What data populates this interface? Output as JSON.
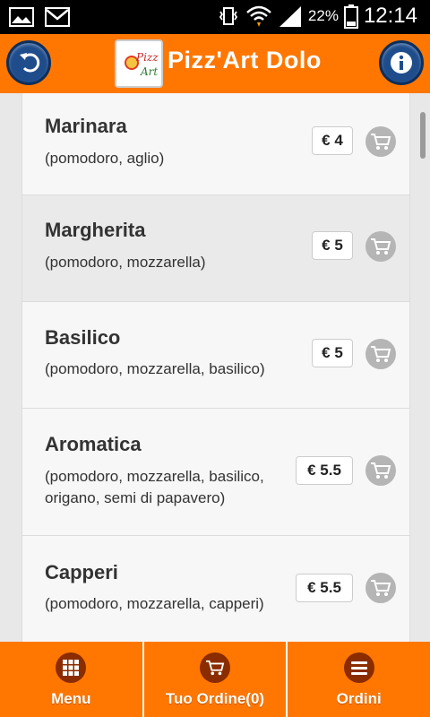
{
  "status_bar": {
    "battery": "22%",
    "time": "12:14"
  },
  "header": {
    "title": "Pizz'Art Dolo",
    "logo_text": "Pizz Art"
  },
  "menu_items": [
    {
      "name": "Marinara",
      "desc": "(pomodoro, aglio)",
      "price": "€ 4"
    },
    {
      "name": "Margherita",
      "desc": "(pomodoro, mozzarella)",
      "price": "€ 5"
    },
    {
      "name": "Basilico",
      "desc": "(pomodoro, mozzarella, basilico)",
      "price": "€ 5"
    },
    {
      "name": "Aromatica",
      "desc": "(pomodoro, mozzarella, basilico,",
      "desc2": "origano, semi di papavero)",
      "price": "€ 5.5"
    },
    {
      "name": "Capperi",
      "desc": "(pomodoro, mozzarella, capperi)",
      "price": "€ 5.5"
    }
  ],
  "bottom_nav": {
    "menu": "Menu",
    "order": "Tuo Ordine(0)",
    "orders": "Ordini"
  },
  "colors": {
    "accent": "#ff7700",
    "button_blue": "#1f4d8c",
    "nav_icon": "#8a2b00"
  }
}
